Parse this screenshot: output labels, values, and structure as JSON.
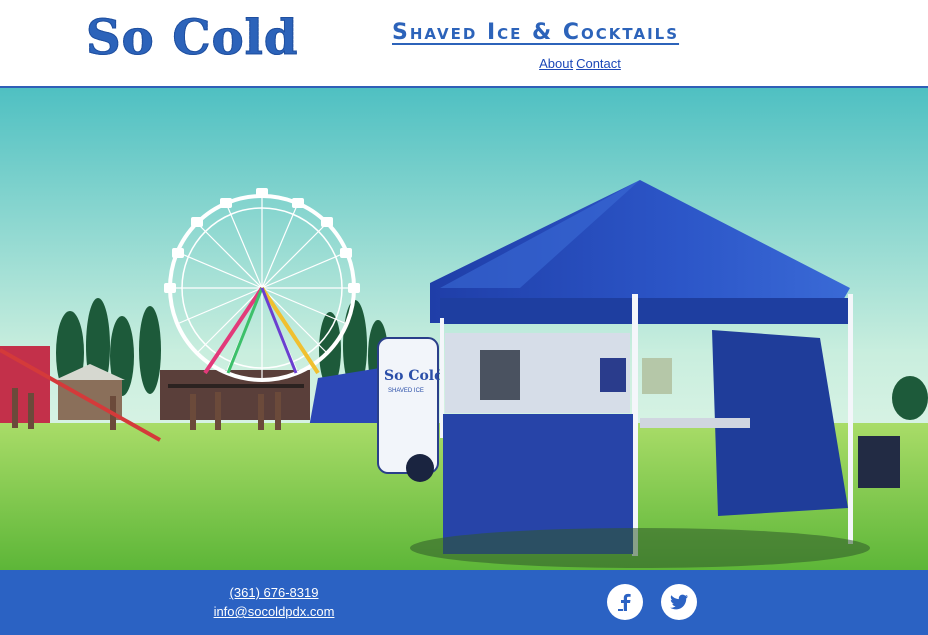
{
  "header": {
    "logo_text": "So Cold",
    "tagline": "Shaved Ice & Cocktails",
    "nav": [
      "About",
      "Contact"
    ]
  },
  "hero": {
    "trailer_logo": "So Cold",
    "trailer_sub": "SHAVED ICE"
  },
  "footer": {
    "phone": "(361) 676-8319",
    "email": "info@socoldpdx.com",
    "social": [
      {
        "icon": "facebook-icon"
      },
      {
        "icon": "twitter-icon"
      }
    ]
  },
  "colors": {
    "brand_blue": "#2c63ba",
    "footer_blue": "#2b62c3",
    "nav_link": "#1c48b8"
  }
}
